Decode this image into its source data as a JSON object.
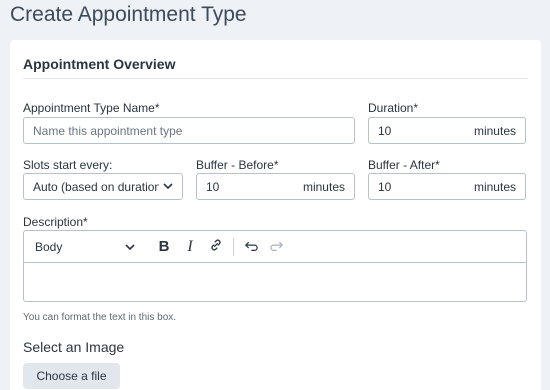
{
  "page": {
    "title": "Create Appointment Type"
  },
  "overview": {
    "title": "Appointment Overview",
    "name": {
      "label": "Appointment Type Name*",
      "placeholder": "Name this appointment type"
    },
    "duration": {
      "label": "Duration*",
      "value": "10",
      "unit": "minutes"
    },
    "slots": {
      "label": "Slots start every:",
      "value": "Auto (based on duration"
    },
    "buffer_before": {
      "label": "Buffer - Before*",
      "value": "10",
      "unit": "minutes"
    },
    "buffer_after": {
      "label": "Buffer - After*",
      "value": "10",
      "unit": "minutes"
    },
    "description": {
      "label": "Description*",
      "format_value": "Body",
      "helper": "You can format the text in this box."
    },
    "image": {
      "title": "Select an Image",
      "button": "Choose a file"
    }
  },
  "icons": {
    "format_dropdown": "chevron-down-icon",
    "bold": "bold-icon",
    "italic": "italic-icon",
    "link": "link-icon",
    "undo": "undo-icon",
    "redo": "redo-icon"
  }
}
